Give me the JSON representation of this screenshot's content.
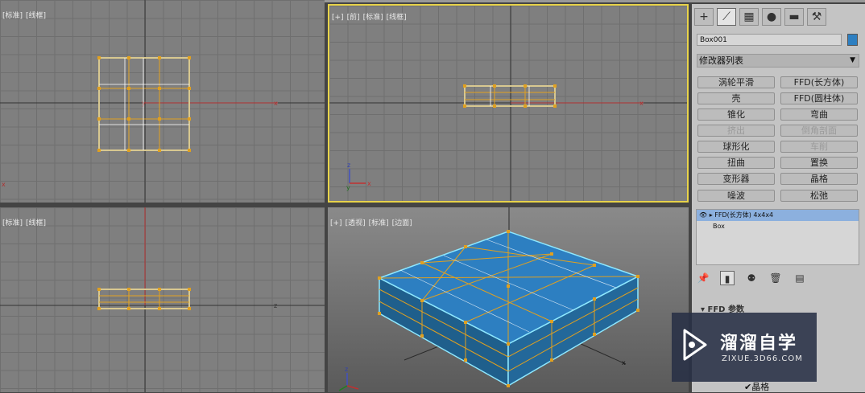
{
  "viewports": {
    "top_left": {
      "labels": [
        "[标准]",
        "[线框]"
      ]
    },
    "top_right": {
      "labels": [
        "[+]",
        "[前]",
        "[标准]",
        "[线框]"
      ]
    },
    "bottom_left": {
      "labels": [
        "[标准]",
        "[线框]"
      ]
    },
    "bottom_right": {
      "labels": [
        "[+]",
        "[透视]",
        "[标准]",
        "[边面]"
      ]
    }
  },
  "panel": {
    "tabs": [
      "create-icon",
      "modify-icon",
      "hierarchy-icon",
      "motion-icon",
      "display-icon",
      "utilities-icon"
    ],
    "tab_glyphs": [
      "+",
      "⟋",
      "▦",
      "●",
      "▬",
      "⚒"
    ],
    "object_name": "Box001",
    "object_color": "#2d7fc1",
    "modifier_list": "修改器列表",
    "modifiers": [
      {
        "label": "涡轮平滑",
        "enabled": true
      },
      {
        "label": "FFD(长方体)",
        "enabled": true
      },
      {
        "label": "壳",
        "enabled": true
      },
      {
        "label": "FFD(圆柱体)",
        "enabled": true
      },
      {
        "label": "锥化",
        "enabled": true
      },
      {
        "label": "弯曲",
        "enabled": true
      },
      {
        "label": "挤出",
        "enabled": false
      },
      {
        "label": "倒角剖面",
        "enabled": false
      },
      {
        "label": "球形化",
        "enabled": true
      },
      {
        "label": "车削",
        "enabled": false
      },
      {
        "label": "扭曲",
        "enabled": true
      },
      {
        "label": "置换",
        "enabled": true
      },
      {
        "label": "变形器",
        "enabled": true
      },
      {
        "label": "晶格",
        "enabled": true
      },
      {
        "label": "噪波",
        "enabled": true
      },
      {
        "label": "松弛",
        "enabled": true
      }
    ],
    "stack": [
      {
        "label": "FFD(长方体) 4x4x4",
        "selected": true
      },
      {
        "label": "Box",
        "selected": false
      }
    ],
    "stack_tools": [
      "pin-icon",
      "show-end-result-icon",
      "make-unique-icon",
      "remove-modifier-icon",
      "configure-icon"
    ],
    "rollout_title": "FFD 参数",
    "lattice_label": "晶格"
  },
  "watermark": {
    "title": "溜溜自学",
    "url": "ZIXUE.3D66.COM"
  }
}
